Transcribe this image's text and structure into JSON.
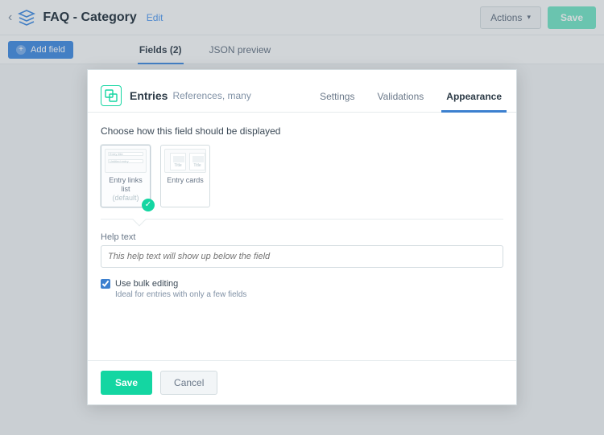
{
  "topbar": {
    "title": "FAQ - Category",
    "edit": "Edit",
    "actions": "Actions",
    "save": "Save"
  },
  "secondbar": {
    "add_field": "Add field",
    "tabs": [
      {
        "label": "Fields (2)",
        "active": true
      },
      {
        "label": "JSON preview",
        "active": false
      }
    ]
  },
  "modal": {
    "field_name": "Entries",
    "field_type": "References, many",
    "tabs": [
      {
        "label": "Settings",
        "active": false
      },
      {
        "label": "Validations",
        "active": false
      },
      {
        "label": "Appearance",
        "active": true
      }
    ],
    "section_label": "Choose how this field should be displayed",
    "options": [
      {
        "title": "Entry links list",
        "subtitle": "(default)",
        "selected": true
      },
      {
        "title": "Entry cards",
        "subtitle": "",
        "selected": false
      }
    ],
    "preview": {
      "line1": "Entry title",
      "line2": "Untitled entry",
      "card_label": "Title"
    },
    "help_label": "Help text",
    "help_placeholder": "This help text will show up below the field",
    "bulk_label": "Use bulk editing",
    "bulk_checked": true,
    "bulk_note": "Ideal for entries with only a few fields",
    "save": "Save",
    "cancel": "Cancel"
  }
}
